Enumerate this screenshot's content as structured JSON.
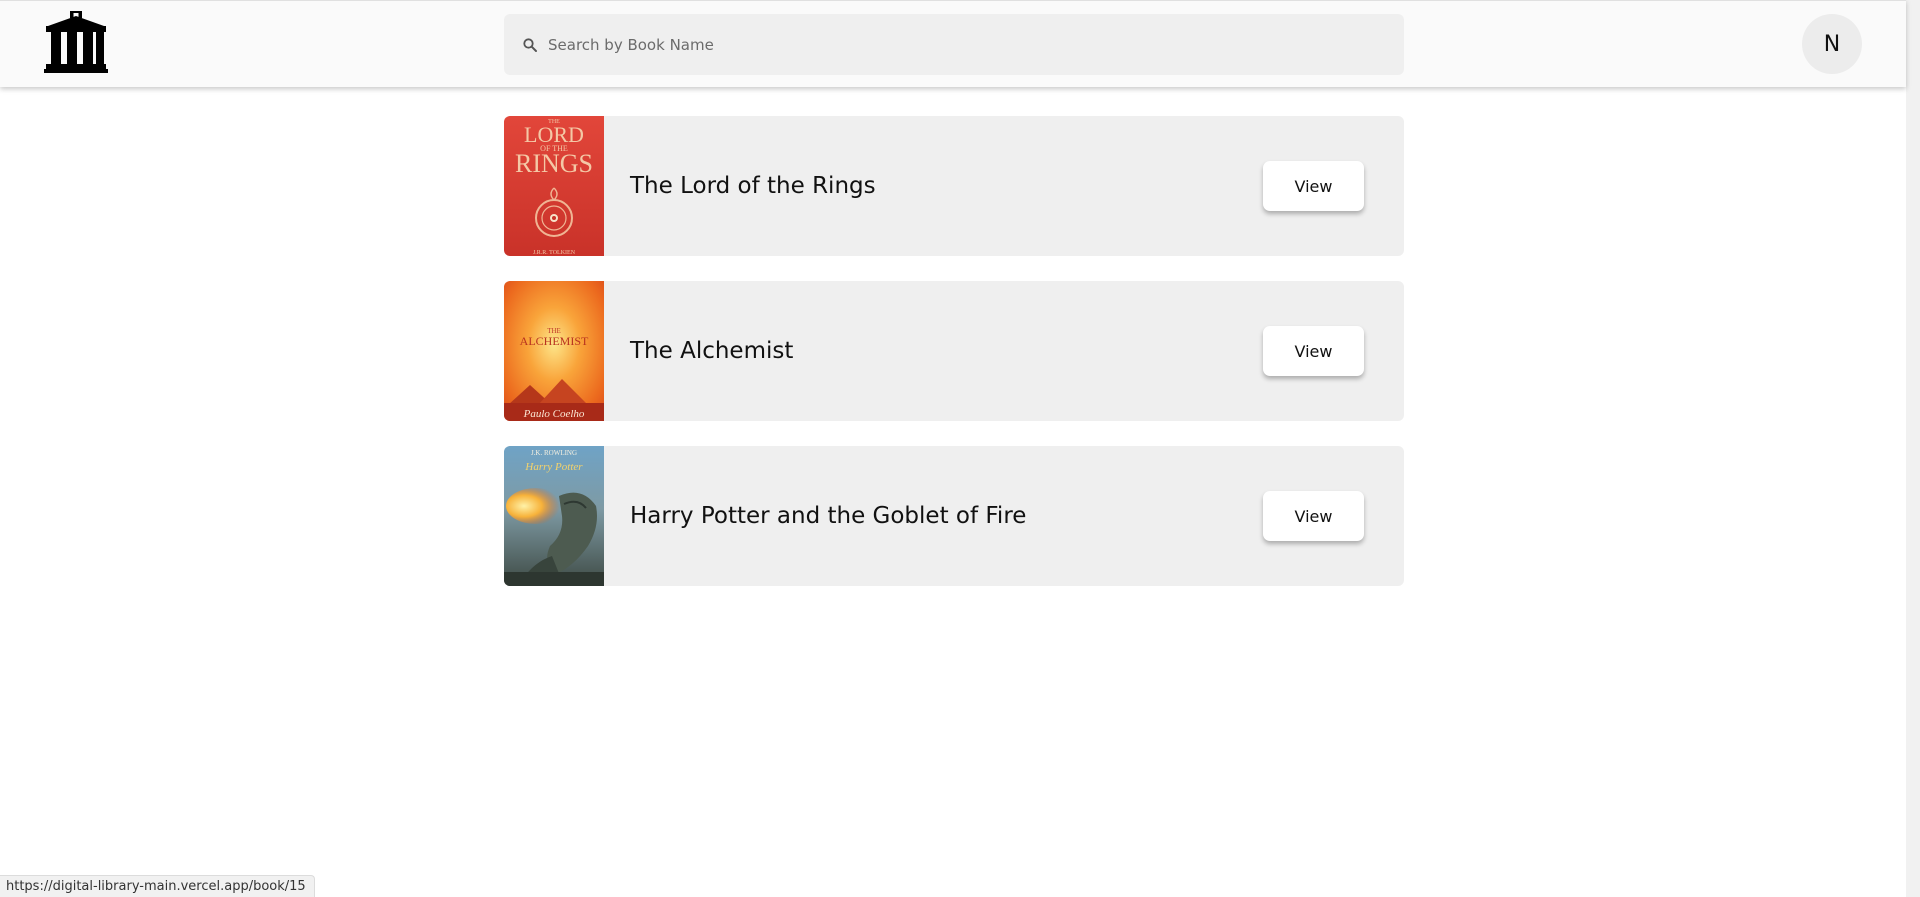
{
  "header": {
    "logo_icon": "library-building-icon",
    "search": {
      "placeholder": "Search by Book Name",
      "value": "",
      "icon": "search-icon"
    },
    "avatar_initial": "N"
  },
  "books": [
    {
      "title": "The Lord of the Rings",
      "view_label": "View",
      "cover": "lord-of-the-rings-cover"
    },
    {
      "title": "The Alchemist",
      "view_label": "View",
      "cover": "the-alchemist-cover"
    },
    {
      "title": "Harry Potter and the Goblet of Fire",
      "view_label": "View",
      "cover": "harry-potter-goblet-of-fire-cover"
    }
  ],
  "covers": {
    "lotr": {
      "line1": "THE",
      "line2": "LORD",
      "line3": "OF THE",
      "line4": "RINGS",
      "author": "J.R.R. TOLKIEN"
    },
    "alchemist": {
      "title_small": "THE",
      "title": "ALCHEMIST",
      "author": "Paulo Coelho"
    },
    "hp": {
      "author": "J.K. ROWLING",
      "series": "Harry Potter"
    }
  },
  "status_bar": {
    "url": "https://digital-library-main.vercel.app/book/15"
  },
  "colors": {
    "header_bg": "#fafafa",
    "card_bg": "#efefef",
    "search_bg": "#efefef",
    "avatar_bg": "#ececec",
    "text": "#111111"
  }
}
